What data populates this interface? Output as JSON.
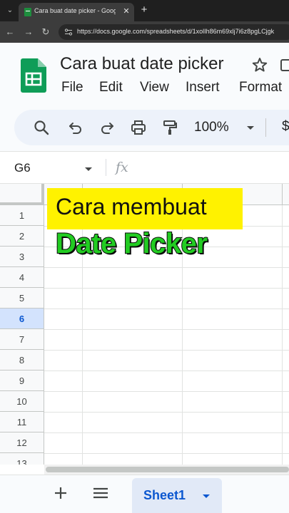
{
  "browser": {
    "tab_title": "Cara buat date picker - Google",
    "url": "https://docs.google.com/spreadsheets/d/1xolIh86m69xlj7i6z8pgLCjgk"
  },
  "header": {
    "doc_title": "Cara buat date picker",
    "menu": [
      "File",
      "Edit",
      "View",
      "Insert",
      "Format"
    ]
  },
  "toolbar": {
    "icons": [
      "search-icon",
      "undo-icon",
      "redo-icon",
      "print-icon",
      "paint-format-icon"
    ],
    "zoom": "100%",
    "currency": "$"
  },
  "formula_bar": {
    "cell_ref": "G6",
    "fx": "fx"
  },
  "grid": {
    "rows": [
      "1",
      "2",
      "3",
      "4",
      "5",
      "6",
      "7",
      "8",
      "9",
      "10",
      "11",
      "12",
      "13"
    ],
    "active_row": "6"
  },
  "overlay": {
    "line1": "Cara membuat",
    "line2": "Date Picker",
    "banner_color": "#fff200",
    "headline_color": "#22cc22"
  },
  "sheets": {
    "active": "Sheet1"
  },
  "colors": {
    "sheets_green": "#0f9d58",
    "accent_blue": "#0b57d0"
  }
}
